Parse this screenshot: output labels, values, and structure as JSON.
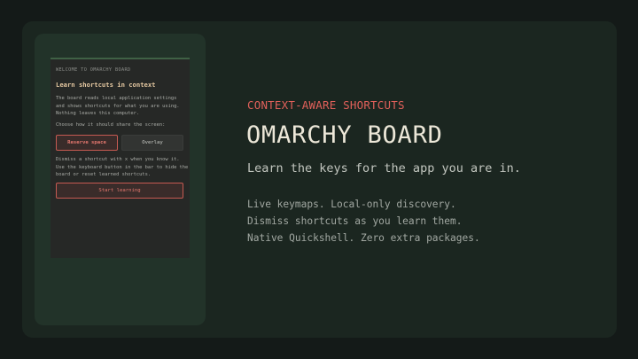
{
  "onboarding": {
    "kicker": "WELCOME TO OMARCHY BOARD",
    "title": "Learn shortcuts in context",
    "description": "The board reads local application settings and shows shortcuts for what you are using. Nothing leaves this computer.",
    "choose_prompt": "Choose how it should share the screen:",
    "reserve_label": "Reserve space",
    "overlay_label": "Overlay",
    "help_text": "Dismiss a shortcut with x when you know it. Use the keyboard button in the bar to hide the board or reset learned shortcuts.",
    "start_label": "Start learning"
  },
  "hero": {
    "kicker": "CONTEXT-AWARE SHORTCUTS",
    "title": "OMARCHY BOARD",
    "subtitle": "Learn the keys for the app you are in.",
    "features": [
      "Live keymaps. Local-only discovery.",
      "Dismiss shortcuts as you learn them.",
      "Native Quickshell. Zero extra packages."
    ]
  },
  "colors": {
    "accent": "#e0605a",
    "background": "#141a18",
    "card": "#1b2620",
    "panel": "#223329"
  }
}
